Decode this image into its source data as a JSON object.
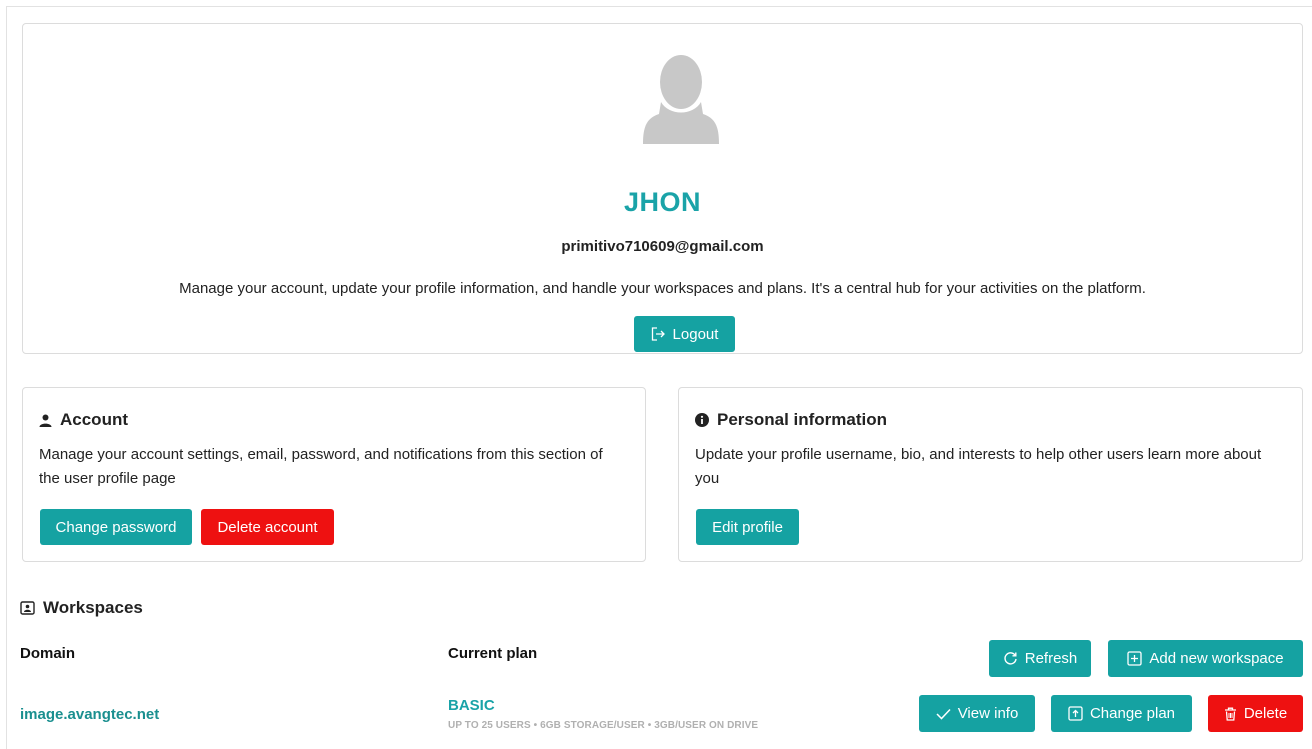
{
  "profile": {
    "name": "JHON",
    "email": "primitivo710609@gmail.com",
    "description": "Manage your account, update your profile information, and handle your workspaces and plans. It's a central hub for your activities on the platform.",
    "logout_label": "Logout",
    "avatar_icon": "user-silhouette-icon"
  },
  "account": {
    "title": "Account",
    "icon": "user-icon",
    "description": "Manage your account settings, email, password, and notifications from this section of the user profile page",
    "change_password_label": "Change password",
    "delete_account_label": "Delete account"
  },
  "personal_info": {
    "title": "Personal information",
    "icon": "info-icon",
    "description": "Update your profile username, bio, and interests to help other users learn more about you",
    "edit_profile_label": "Edit profile"
  },
  "workspaces": {
    "title": "Workspaces",
    "icon": "workspace-icon",
    "columns": {
      "domain": "Domain",
      "plan": "Current plan"
    },
    "refresh_label": "Refresh",
    "add_label": "Add new workspace",
    "rows": [
      {
        "domain": "image.avangtec.net",
        "plan_name": "BASIC",
        "plan_details": "UP TO 25 USERS • 6GB STORAGE/USER • 3GB/USER ON DRIVE",
        "view_info_label": "View info",
        "change_plan_label": "Change plan",
        "delete_label": "Delete"
      }
    ]
  },
  "colors": {
    "accent": "#15a2a2",
    "danger": "#ee1111",
    "name": "#1aa3a8"
  }
}
